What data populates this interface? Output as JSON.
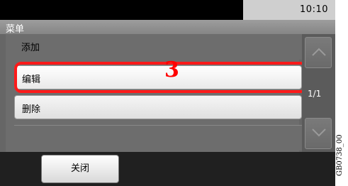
{
  "status_bar": {
    "time": "10:10"
  },
  "header": {
    "title": "菜单"
  },
  "menu": {
    "items": [
      {
        "label": "添加"
      },
      {
        "label": "编辑"
      },
      {
        "label": "删除"
      },
      {
        "label": ""
      }
    ]
  },
  "annotation": {
    "step_number": "3"
  },
  "pagination": {
    "indicator": "1/1"
  },
  "bottom": {
    "close_label": "关闭"
  },
  "figure": {
    "credit": "GB0738_00"
  },
  "colors": {
    "highlight": "#ff1a1a"
  }
}
